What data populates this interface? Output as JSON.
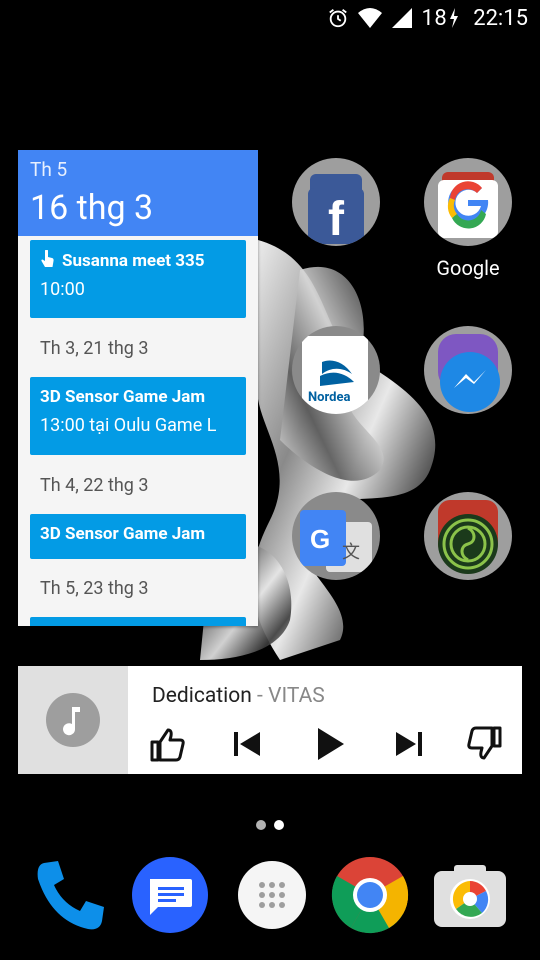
{
  "status": {
    "battery": "18",
    "time": "22:15"
  },
  "calendar": {
    "weekday": "Th 5",
    "date": "16 thg 3",
    "events": [
      {
        "title": "Susanna meet 335",
        "time": "10:00"
      },
      {
        "title": "3D Sensor Game Jam",
        "time": "13:00 tại Oulu Game L"
      },
      {
        "title": "3D Sensor Game Jam",
        "time": ""
      }
    ],
    "day_headers": [
      "Th 3, 21 thg 3",
      "Th 4, 22 thg 3",
      "Th 5, 23 thg 3"
    ]
  },
  "apps": {
    "google_label": "Google",
    "nordea_label": "Nordea"
  },
  "music": {
    "title": "Dedication",
    "separator": " - ",
    "artist": "VITAS"
  },
  "colors": {
    "calendar_header": "#4285f4",
    "event_blue": "#039be5",
    "facebook": "#3b5998",
    "messenger": "#1e88e5"
  },
  "icons": [
    "alarm-icon",
    "wifi-icon",
    "signal-icon",
    "battery-charging-icon",
    "thumbs-up-icon",
    "previous-icon",
    "play-icon",
    "next-icon",
    "thumbs-down-icon",
    "phone-icon",
    "messages-icon",
    "app-drawer-icon",
    "chrome-icon",
    "camera-icon"
  ]
}
